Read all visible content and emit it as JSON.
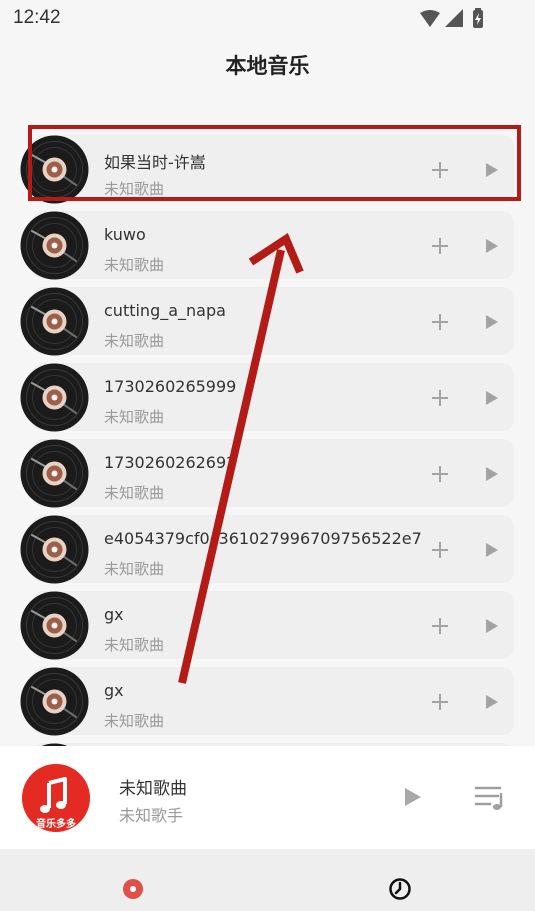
{
  "status_bar": {
    "time": "12:42"
  },
  "page": {
    "title": "本地音乐"
  },
  "songs": [
    {
      "title": "如果当时-许嵩",
      "subtitle": "未知歌曲"
    },
    {
      "title": "kuwo",
      "subtitle": "未知歌曲"
    },
    {
      "title": "cutting_a_napa",
      "subtitle": "未知歌曲"
    },
    {
      "title": "1730260265999",
      "subtitle": "未知歌曲"
    },
    {
      "title": "1730260262692",
      "subtitle": "未知歌曲"
    },
    {
      "title": "e4054379cf0c361027996709756522e7",
      "subtitle": "未知歌曲"
    },
    {
      "title": "gx",
      "subtitle": "未知歌曲"
    },
    {
      "title": "gx",
      "subtitle": "未知歌曲"
    },
    {
      "title": "",
      "subtitle": ""
    }
  ],
  "player": {
    "title": "未知歌曲",
    "artist": "未知歌手",
    "cover_text": "音乐多多"
  },
  "colors": {
    "accent": "#e0504a",
    "annotation": "#b31b17",
    "cover": "#e32b24"
  },
  "icons": {
    "add": "plus-icon",
    "play": "play-icon",
    "playlist": "playlist-icon",
    "tab_music": "music-disc-icon",
    "tab_history": "clock-icon"
  }
}
